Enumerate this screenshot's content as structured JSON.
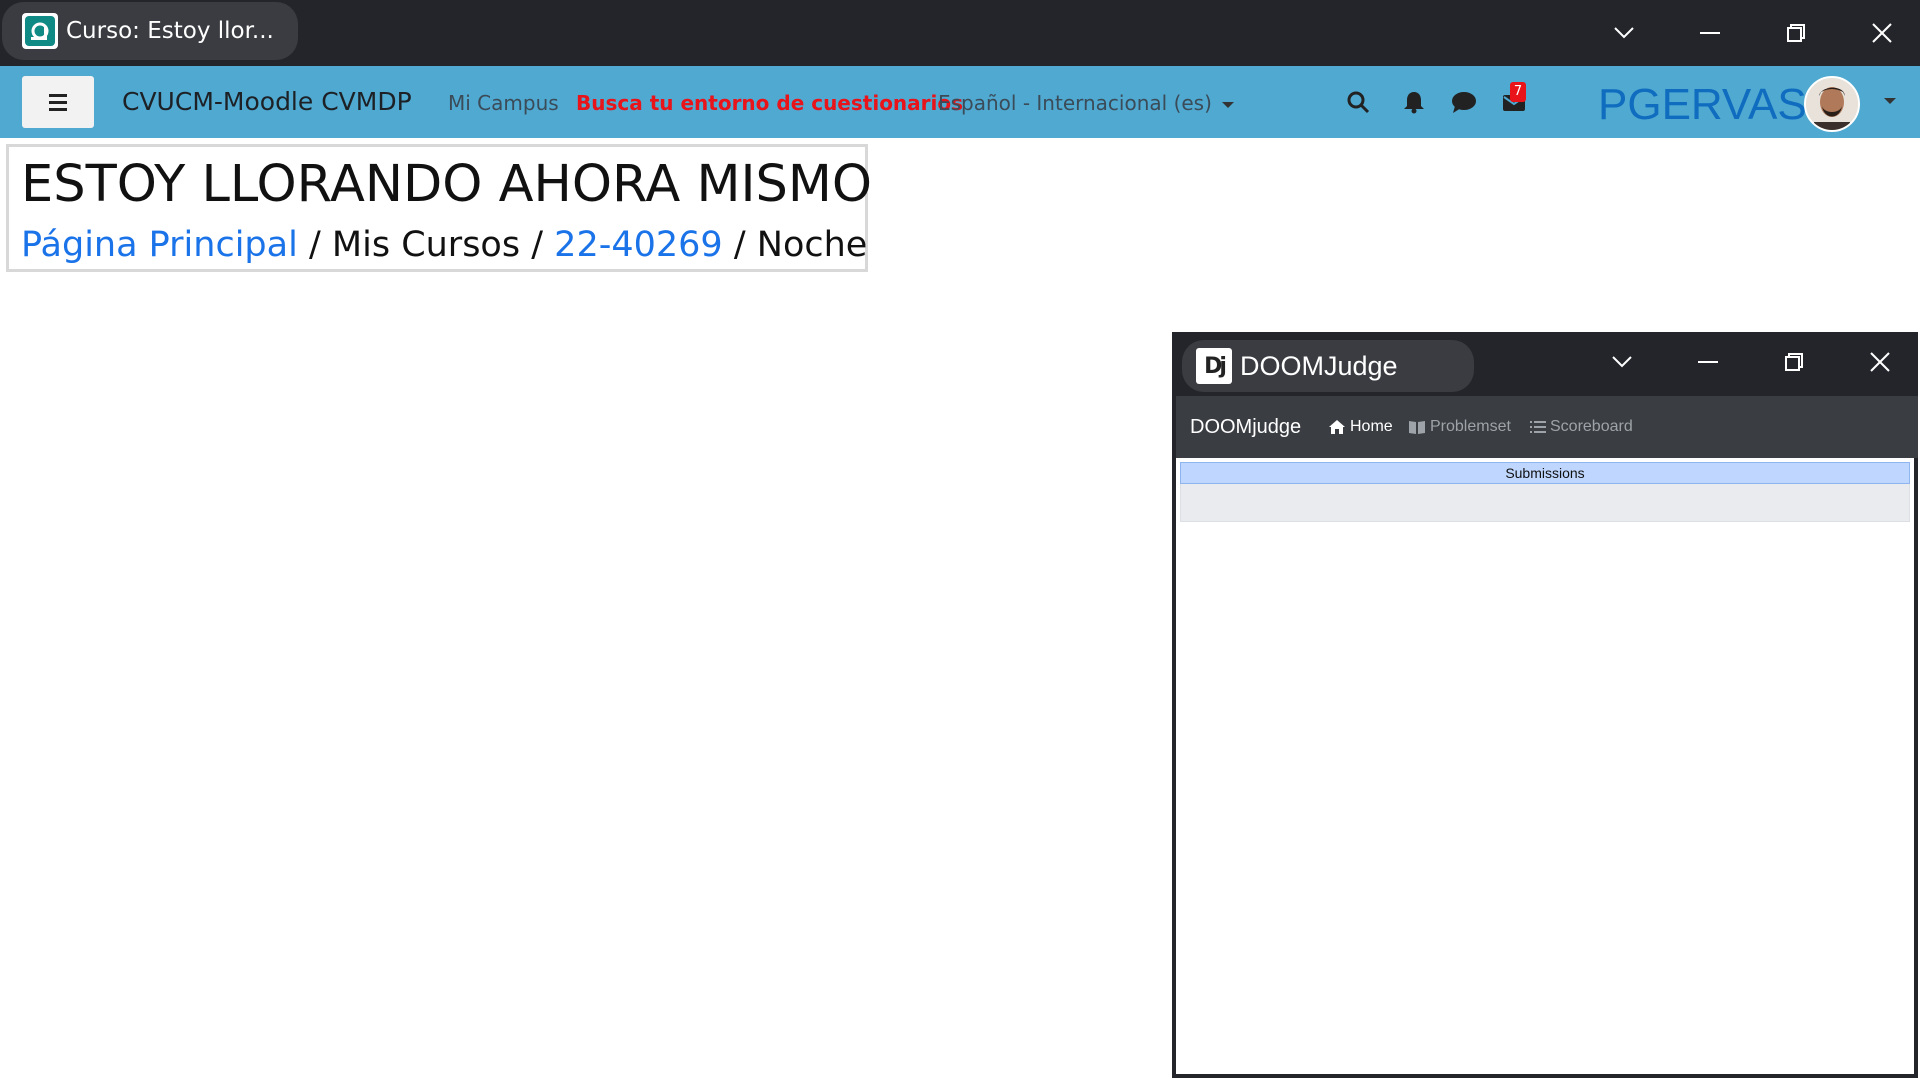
{
  "browser": {
    "tab_title": "Curso: Estoy llor...",
    "controls": [
      "chevron-down-icon",
      "minimize-icon",
      "restore-icon",
      "close-icon"
    ]
  },
  "moodle": {
    "site_name": "CVUCM-Moodle CVMDP",
    "nav": {
      "mi_campus": "Mi Campus",
      "busca": "Busca tu entorno de cuestionarios",
      "language": "Español - Internacional (es)"
    },
    "messages_badge": "7",
    "user_name": "PGERVAS",
    "colors": {
      "navbar": "#4fa9d1",
      "hot_link": "#e8141a",
      "link": "#1a73e8"
    },
    "page_heading": "ESTOY LLORANDO AHORA MISMO",
    "breadcrumb": {
      "home": "Página Principal",
      "sep1": "/",
      "mis_cursos": "Mis Cursos",
      "sep2": "/",
      "course_code": "22-40269",
      "sep3": "/",
      "current": "Noche"
    }
  },
  "doomjudge": {
    "window_title": "DOOMJudge",
    "logo_text": "Dj",
    "brand": "DOOMjudge",
    "nav": {
      "home": "Home",
      "problemset": "Problemset",
      "scoreboard": "Scoreboard"
    },
    "submissions_header": "Submissions"
  }
}
